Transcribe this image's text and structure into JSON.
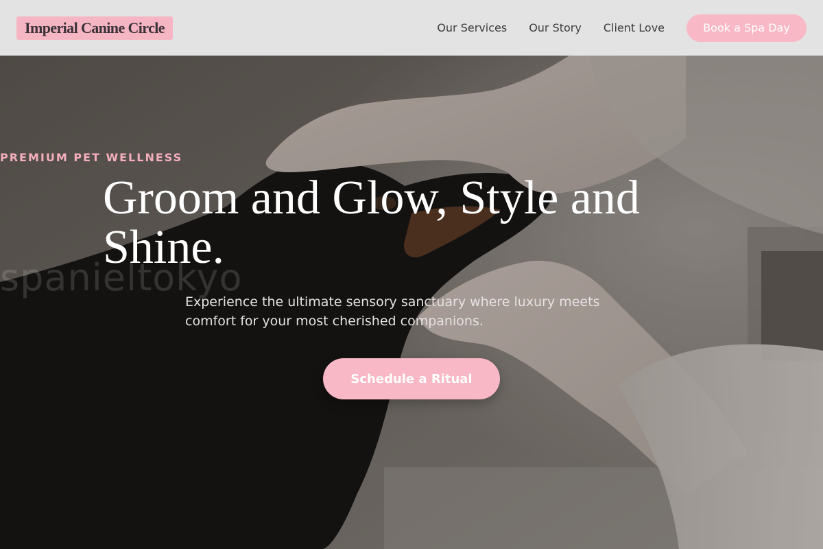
{
  "header": {
    "logo_text": "Imperial Canine Circle",
    "nav": [
      {
        "label": "Our Services"
      },
      {
        "label": "Our Story"
      },
      {
        "label": "Client Love"
      }
    ],
    "cta_label": "Book a Spa Day"
  },
  "hero": {
    "eyebrow": "PREMIUM PET WELLNESS",
    "headline": "Groom and Glow, Style and Shine.",
    "watermark": "spanieltokyo",
    "subtitle": "Experience the ultimate sensory sanctuary where luxury meets comfort for your most cherished companions.",
    "cta_label": "Schedule a Ritual"
  },
  "colors": {
    "accent_pink": "#f9b8c6",
    "header_bg": "#e3e3e3",
    "eyebrow_pink": "#f4aebd"
  }
}
